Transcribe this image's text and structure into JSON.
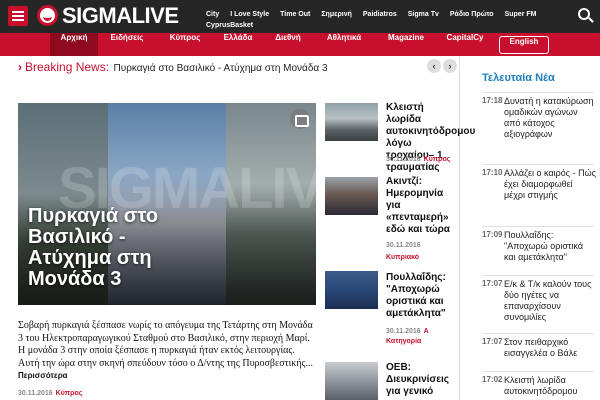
{
  "header": {
    "logo_text": "SIGMALIVE",
    "links": [
      "City",
      "I Love Style",
      "Time Out",
      "Σημερινή",
      "Paidiatros",
      "Sigma Tv",
      "Ράδιο Πρώτο",
      "Super FM",
      "CyprusBasket"
    ]
  },
  "nav": {
    "items": [
      "Αρχική",
      "Ειδήσεις",
      "Κύπρος",
      "Ελλάδα",
      "Διεθνή",
      "Αθλητικά",
      "Magazine",
      "CapitalCy"
    ],
    "english": "English"
  },
  "breaking": {
    "label": "Breaking News:",
    "text": "Πυρκαγιά στο Βασιλικό - Ατύχημα στη Μονάδα 3"
  },
  "hero": {
    "watermark": "SIGMALIVE",
    "title": "Πυρκαγιά στο Βασιλικό - Ατύχημα στη Μονάδα 3",
    "summary": "Σοβαρή πυρκαγιά ξέσπασε νωρίς το απόγευμα της Τετάρτης στη Μονάδα 3 του Ηλεκτροπαραγωγικού Σταθμού στο Βασιλικό, στην περιοχή Μαρί. Η μονάδα 3 στην οποία ξέσπασε η πυρκαγιά ήταν εκτός λειτουργίας. Αυτή την ώρα στην σκηνή σπεύδουν τόσο ο Δ/ντης της Πυροσβεστικής...",
    "more": "Περισσότερα",
    "date": "30.11.2016",
    "category": "Κύπρος"
  },
  "items": [
    {
      "title": "Κλειστή λωρίδα αυτοκινητόδρομου λόγω τροχαίου– 1 τραυματίας",
      "date": "30.11.2016",
      "category": "Κύπρος"
    },
    {
      "title": "Ακιντζί: Ημερομηνία για «πενταμερή» εδώ και τώρα",
      "date": "30.11.2016",
      "category": "Κυπριακό"
    },
    {
      "title": "Πουλλαΐδης: \"Αποχωρώ οριστικά και αμετάκλητα\"",
      "date": "30.11.2016",
      "category": "Α Κατηγορία"
    },
    {
      "title": "ΟΕΒ: Διευκρινίσεις για γενικό",
      "date": "",
      "category": ""
    }
  ],
  "sidebar": {
    "heading": "Τελευταία Νέα",
    "news": [
      {
        "time": "17:18",
        "text": "Δυνατή η κατακύρωση ομαδικών αγώνων από κάτοχος αξιογράφων"
      },
      {
        "time": "17:10",
        "text": "Αλλάζει ο καιρός - Πώς έχει διαμορφωθεί μέχρι στιγμής"
      },
      {
        "time": "17:09",
        "text": "Πουλλαΐδης: \"Αποχωρώ οριστικά και αμετάκλητα\""
      },
      {
        "time": "17:07",
        "text": "Ε/κ & Τ/κ καλούν τους δύο ηγέτες να επαναρχίσουν συνομιλίες"
      },
      {
        "time": "17:07",
        "text": "Στον πειθαρχικό εισαγγελέα ο Βάλε"
      },
      {
        "time": "17:02",
        "text": "Κλειστή λωρίδα αυτοκινητόδρομου"
      }
    ]
  }
}
